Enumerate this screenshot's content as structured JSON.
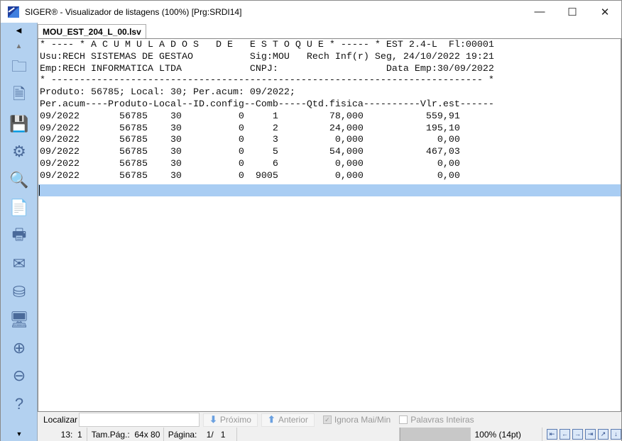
{
  "window": {
    "title": "SIGER® - Visualizador de listagens (100%) [Prg:SRDI14]",
    "minimize": "—",
    "maximize": "☐",
    "close": "✕"
  },
  "tab": {
    "label": "MOU_EST_204_L_00.lsv"
  },
  "sidebar": {
    "icons": [
      "open-folder-icon",
      "close-document-icon",
      "save-icon",
      "settings-icon",
      "preview-icon",
      "pdf-icon",
      "print-icon",
      "email-icon",
      "export-icon",
      "monitor-icon",
      "zoom-in-icon",
      "zoom-out-icon",
      "help-icon"
    ]
  },
  "report": {
    "header_lines": [
      "* ---- * A C U M U L A D O S   D E   E S T O Q U E * ----- * EST 2.4-L  Fl:00001",
      "Usu:RECH SISTEMAS DE GESTAO          Sig:MOU   Rech Inf(r) Seg, 24/10/2022 19:21",
      "Emp:RECH INFORMATICA LTDA            CNPJ:                   Data Emp:30/09/2022",
      "* ---------------------------------------------------------------------------- *",
      "Produto: 56785; Local: 30; Per.acum: 09/2022;",
      "Per.acum----Produto-Local--ID.config--Comb-----Qtd.fisica----------Vlr.est------"
    ],
    "rows": [
      {
        "per": "09/2022",
        "produto": "56785",
        "local": "30",
        "idconfig": "0",
        "comb": "1",
        "qtd": "78,000",
        "vlr": "559,91"
      },
      {
        "per": "09/2022",
        "produto": "56785",
        "local": "30",
        "idconfig": "0",
        "comb": "2",
        "qtd": "24,000",
        "vlr": "195,10"
      },
      {
        "per": "09/2022",
        "produto": "56785",
        "local": "30",
        "idconfig": "0",
        "comb": "3",
        "qtd": "0,000",
        "vlr": "0,00"
      },
      {
        "per": "09/2022",
        "produto": "56785",
        "local": "30",
        "idconfig": "0",
        "comb": "5",
        "qtd": "54,000",
        "vlr": "467,03"
      },
      {
        "per": "09/2022",
        "produto": "56785",
        "local": "30",
        "idconfig": "0",
        "comb": "6",
        "qtd": "0,000",
        "vlr": "0,00"
      },
      {
        "per": "09/2022",
        "produto": "56785",
        "local": "30",
        "idconfig": "0",
        "comb": "9005",
        "qtd": "0,000",
        "vlr": "0,00"
      }
    ]
  },
  "find": {
    "label": "Localizar",
    "value": "",
    "next": "Próximo",
    "prev": "Anterior",
    "ignore_case": "Ignora Mai/Min",
    "whole_words": "Palavras Inteiras"
  },
  "status": {
    "cursor": "13:  1",
    "page_size": "Tam.Pág.:  64x 80",
    "page": "Página:    1/   1",
    "zoom": "100% (14pt)"
  },
  "colors": {
    "sidebar": "#b3d1f0",
    "highlight": "#a9cdf3"
  }
}
